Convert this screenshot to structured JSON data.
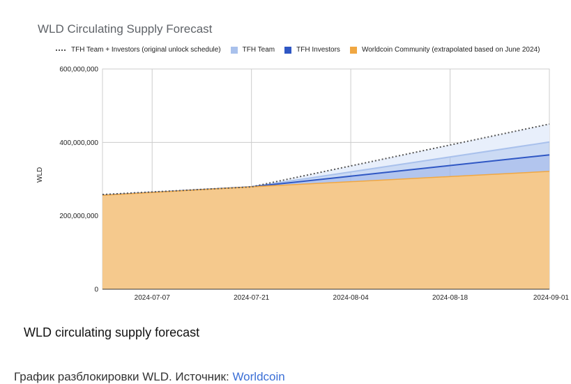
{
  "chart_data": {
    "type": "area",
    "title": "WLD Circulating Supply Forecast",
    "ylabel": "WLD",
    "xlabel": "",
    "x_ticks": [
      "2024-07-07",
      "2024-07-21",
      "2024-08-04",
      "2024-08-18",
      "2024-09-01"
    ],
    "y_ticks": [
      "0",
      "200,000,000",
      "400,000,000",
      "600,000,000"
    ],
    "ylim": [
      0,
      600000000
    ],
    "grid": true,
    "legend_position": "top",
    "x": [
      "2024-06-30",
      "2024-07-21",
      "2024-09-01"
    ],
    "series": [
      {
        "name": "TFH Team + Investors (original unlock schedule)",
        "style": "dotted-line",
        "color": "#555555",
        "values": [
          258000000,
          279000000,
          450000000
        ]
      },
      {
        "name": "TFH Team",
        "style": "stacked-area",
        "color": "#a9c1ec",
        "values": [
          0,
          0,
          35000000
        ]
      },
      {
        "name": "TFH Investors",
        "style": "stacked-area",
        "color": "#2f57c4",
        "values": [
          0,
          0,
          45000000
        ]
      },
      {
        "name": "Worldcoin Community (extrapolated based on June 2024)",
        "style": "stacked-area",
        "color": "#f0a742",
        "values": [
          256000000,
          279000000,
          321000000
        ]
      }
    ]
  },
  "caption": "WLD circulating supply forecast",
  "source": {
    "prefix": "График разблокировки WLD. Источник: ",
    "link_text": "Worldcoin"
  }
}
